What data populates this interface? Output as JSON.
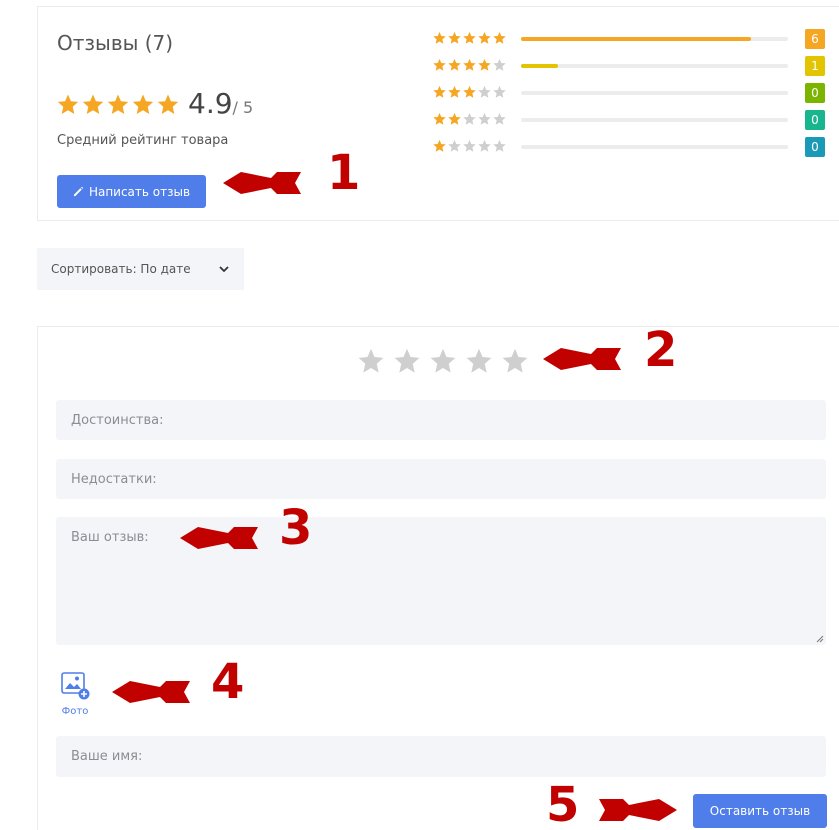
{
  "reviews": {
    "title": "Отзывы (7)",
    "average": "4.9",
    "max_suffix": "/ 5",
    "average_caption": "Средний рейтинг товара",
    "summary_stars": 5,
    "write_button": "Написать отзыв",
    "distribution": [
      {
        "stars": 5,
        "count": "6",
        "fraction": 0.86,
        "bar_color": "#f5a623",
        "badge_color": "#f5a623"
      },
      {
        "stars": 4,
        "count": "1",
        "fraction": 0.14,
        "bar_color": "#e2c400",
        "badge_color": "#e2c400"
      },
      {
        "stars": 3,
        "count": "0",
        "fraction": 0,
        "bar_color": "#7cb500",
        "badge_color": "#7cb500"
      },
      {
        "stars": 2,
        "count": "0",
        "fraction": 0,
        "bar_color": "#19b58e",
        "badge_color": "#19b58e"
      },
      {
        "stars": 1,
        "count": "0",
        "fraction": 0,
        "bar_color": "#1b9ab8",
        "badge_color": "#1b9ab8"
      }
    ]
  },
  "sort": {
    "label": "Сортировать: По дате"
  },
  "form": {
    "rating_stars": 5,
    "pros_placeholder": "Достоинства:",
    "cons_placeholder": "Недостатки:",
    "review_placeholder": "Ваш отзыв:",
    "photo_label": "Фото",
    "name_placeholder": "Ваше имя:",
    "submit_button": "Оставить отзыв"
  },
  "annotations": [
    "1",
    "2",
    "3",
    "4",
    "5"
  ],
  "colors": {
    "accent": "#4f7de9",
    "star_filled": "#f5a623",
    "star_empty": "#cfcfcf",
    "annotation": "#c10000",
    "field_bg": "#f4f5f8"
  }
}
